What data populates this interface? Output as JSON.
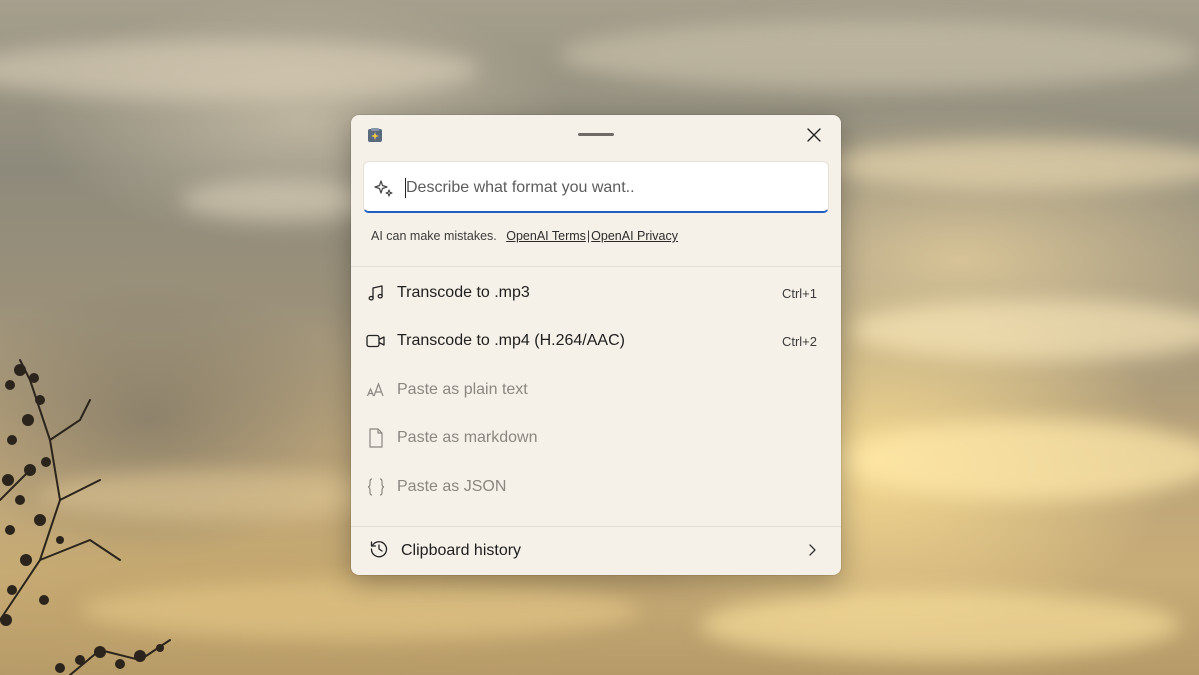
{
  "window": {
    "app_icon": "advanced-paste-icon",
    "close_icon": "close-icon"
  },
  "prompt": {
    "placeholder": "Describe what format you want..",
    "value": "",
    "icon": "sparkle-icon"
  },
  "disclaimer": {
    "text": "AI can make mistakes.",
    "terms_link": "OpenAI Terms",
    "separator": "|",
    "privacy_link": "OpenAI Privacy"
  },
  "actions": [
    {
      "icon": "music-note-icon",
      "label": "Transcode to .mp3",
      "shortcut": "Ctrl+1",
      "enabled": true
    },
    {
      "icon": "video-camera-icon",
      "label": "Transcode to .mp4 (H.264/AAC)",
      "shortcut": "Ctrl+2",
      "enabled": true
    },
    {
      "icon": "text-size-icon",
      "label": "Paste as plain text",
      "shortcut": "",
      "enabled": false
    },
    {
      "icon": "document-icon",
      "label": "Paste as markdown",
      "shortcut": "",
      "enabled": false
    },
    {
      "icon": "braces-icon",
      "label": "Paste as JSON",
      "shortcut": "",
      "enabled": false
    }
  ],
  "footer": {
    "icon": "history-icon",
    "label": "Clipboard history",
    "chevron": "chevron-right-icon"
  },
  "colors": {
    "accent": "#1f5fbf",
    "window_bg": "#f6f1e8",
    "disabled_text": "#8a8680"
  }
}
